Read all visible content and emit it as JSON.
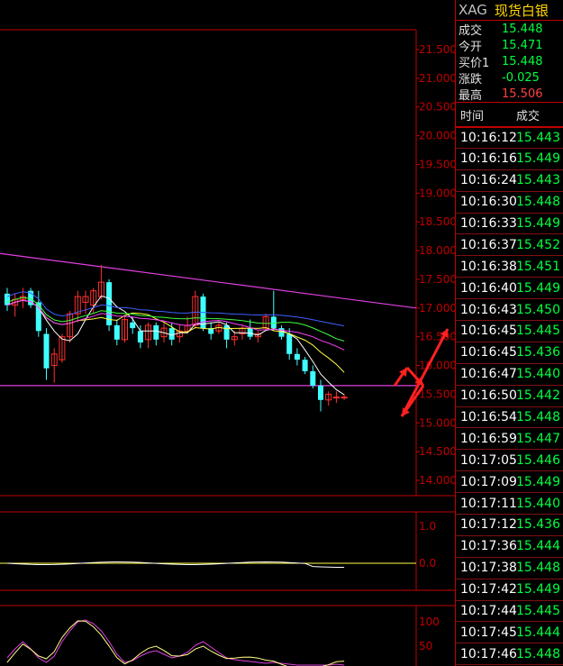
{
  "header": {
    "symbol": "XAG",
    "name": "现货白银"
  },
  "quotes": [
    {
      "label": "成交",
      "value": "15.448",
      "color": "green"
    },
    {
      "label": "今开",
      "value": "15.471",
      "color": "green"
    },
    {
      "label": "买价1",
      "value": "15.448",
      "color": "green"
    },
    {
      "label": "涨跌",
      "value": "-0.025",
      "color": "green"
    },
    {
      "label": "最高",
      "value": "15.506",
      "color": "red"
    }
  ],
  "ticks_header": {
    "time": "时间",
    "price": "成交"
  },
  "ticks": [
    {
      "time": "10:16:12",
      "price": "15.443"
    },
    {
      "time": "10:16:16",
      "price": "15.449"
    },
    {
      "time": "10:16:24",
      "price": "15.443"
    },
    {
      "time": "10:16:30",
      "price": "15.448"
    },
    {
      "time": "10:16:33",
      "price": "15.449"
    },
    {
      "time": "10:16:37",
      "price": "15.452"
    },
    {
      "time": "10:16:38",
      "price": "15.451"
    },
    {
      "time": "10:16:40",
      "price": "15.449"
    },
    {
      "time": "10:16:43",
      "price": "15.450"
    },
    {
      "time": "10:16:45",
      "price": "15.445"
    },
    {
      "time": "10:16:45",
      "price": "15.436"
    },
    {
      "time": "10:16:47",
      "price": "15.440"
    },
    {
      "time": "10:16:50",
      "price": "15.442"
    },
    {
      "time": "10:16:54",
      "price": "15.448"
    },
    {
      "time": "10:16:59",
      "price": "15.447"
    },
    {
      "time": "10:17:05",
      "price": "15.446"
    },
    {
      "time": "10:17:09",
      "price": "15.449"
    },
    {
      "time": "10:17:11",
      "price": "15.440"
    },
    {
      "time": "10:17:12",
      "price": "15.436"
    },
    {
      "time": "10:17:36",
      "price": "15.444"
    },
    {
      "time": "10:17:38",
      "price": "15.448"
    },
    {
      "time": "10:17:42",
      "price": "15.449"
    },
    {
      "time": "10:17:44",
      "price": "15.445"
    },
    {
      "time": "10:17:45",
      "price": "15.444"
    },
    {
      "time": "10:17:46",
      "price": "15.448"
    }
  ],
  "colors": {
    "up": "#ff3030",
    "down": "#40ffff",
    "grid": "#c00000",
    "axis_text": "#c00000",
    "trend": "#e040e0",
    "annot": "#ff2020"
  },
  "chart_data": {
    "type": "candlestick",
    "price_axis": {
      "ticks": [
        "21.500",
        "21.000",
        "20.500",
        "20.000",
        "19.500",
        "19.000",
        "18.500",
        "18.000",
        "17.500",
        "17.000",
        "16.500",
        "16.000",
        "15.500",
        "15.000",
        "14.500",
        "14.000"
      ],
      "ylim": [
        13.8,
        21.9
      ]
    },
    "candles": [
      {
        "o": 17.25,
        "h": 17.35,
        "l": 16.95,
        "c": 17.05
      },
      {
        "o": 17.05,
        "h": 17.25,
        "l": 16.85,
        "c": 17.15
      },
      {
        "o": 17.15,
        "h": 17.35,
        "l": 17.0,
        "c": 17.2
      },
      {
        "o": 17.3,
        "h": 17.35,
        "l": 17.0,
        "c": 17.05
      },
      {
        "o": 17.1,
        "h": 17.3,
        "l": 16.5,
        "c": 16.6
      },
      {
        "o": 16.55,
        "h": 16.65,
        "l": 15.75,
        "c": 15.95
      },
      {
        "o": 16.0,
        "h": 16.3,
        "l": 15.7,
        "c": 16.2
      },
      {
        "o": 16.1,
        "h": 16.55,
        "l": 16.05,
        "c": 16.5
      },
      {
        "o": 16.5,
        "h": 16.95,
        "l": 16.4,
        "c": 16.9
      },
      {
        "o": 16.9,
        "h": 17.3,
        "l": 16.75,
        "c": 17.2
      },
      {
        "o": 17.1,
        "h": 17.3,
        "l": 16.9,
        "c": 17.2
      },
      {
        "o": 17.05,
        "h": 17.35,
        "l": 16.9,
        "c": 17.3
      },
      {
        "o": 17.2,
        "h": 17.75,
        "l": 17.15,
        "c": 17.45
      },
      {
        "o": 17.45,
        "h": 17.5,
        "l": 16.6,
        "c": 16.7
      },
      {
        "o": 16.7,
        "h": 16.8,
        "l": 16.35,
        "c": 16.45
      },
      {
        "o": 16.45,
        "h": 16.85,
        "l": 16.4,
        "c": 16.8
      },
      {
        "o": 16.75,
        "h": 16.85,
        "l": 16.55,
        "c": 16.65
      },
      {
        "o": 16.6,
        "h": 16.7,
        "l": 16.3,
        "c": 16.4
      },
      {
        "o": 16.45,
        "h": 16.75,
        "l": 16.3,
        "c": 16.7
      },
      {
        "o": 16.7,
        "h": 16.75,
        "l": 16.35,
        "c": 16.45
      },
      {
        "o": 16.5,
        "h": 16.75,
        "l": 16.4,
        "c": 16.65
      },
      {
        "o": 16.65,
        "h": 16.75,
        "l": 16.35,
        "c": 16.45
      },
      {
        "o": 16.5,
        "h": 16.7,
        "l": 16.4,
        "c": 16.6
      },
      {
        "o": 16.6,
        "h": 16.85,
        "l": 16.55,
        "c": 16.7
      },
      {
        "o": 16.7,
        "h": 17.3,
        "l": 16.65,
        "c": 17.2
      },
      {
        "o": 17.2,
        "h": 17.25,
        "l": 16.6,
        "c": 16.65
      },
      {
        "o": 16.65,
        "h": 16.75,
        "l": 16.45,
        "c": 16.55
      },
      {
        "o": 16.6,
        "h": 16.75,
        "l": 16.55,
        "c": 16.7
      },
      {
        "o": 16.7,
        "h": 16.75,
        "l": 16.3,
        "c": 16.45
      },
      {
        "o": 16.45,
        "h": 16.6,
        "l": 16.35,
        "c": 16.5
      },
      {
        "o": 16.55,
        "h": 16.7,
        "l": 16.45,
        "c": 16.65
      },
      {
        "o": 16.65,
        "h": 16.8,
        "l": 16.45,
        "c": 16.5
      },
      {
        "o": 16.5,
        "h": 16.6,
        "l": 16.4,
        "c": 16.55
      },
      {
        "o": 16.65,
        "h": 16.9,
        "l": 16.6,
        "c": 16.85
      },
      {
        "o": 16.85,
        "h": 17.3,
        "l": 16.6,
        "c": 16.65
      },
      {
        "o": 16.65,
        "h": 16.7,
        "l": 16.45,
        "c": 16.5
      },
      {
        "o": 16.55,
        "h": 16.65,
        "l": 16.1,
        "c": 16.2
      },
      {
        "o": 16.2,
        "h": 16.3,
        "l": 16.0,
        "c": 16.1
      },
      {
        "o": 16.1,
        "h": 16.15,
        "l": 15.85,
        "c": 15.9
      },
      {
        "o": 15.9,
        "h": 16.0,
        "l": 15.6,
        "c": 15.65
      },
      {
        "o": 15.65,
        "h": 15.75,
        "l": 15.2,
        "c": 15.4
      },
      {
        "o": 15.4,
        "h": 15.55,
        "l": 15.3,
        "c": 15.5
      },
      {
        "o": 15.45,
        "h": 15.55,
        "l": 15.35,
        "c": 15.45
      },
      {
        "o": 15.45,
        "h": 15.5,
        "l": 15.4,
        "c": 15.45
      }
    ],
    "indicator1": {
      "ticks": [
        "1.0",
        "0.0"
      ]
    },
    "indicator2": {
      "ticks": [
        "100",
        "50"
      ]
    }
  }
}
